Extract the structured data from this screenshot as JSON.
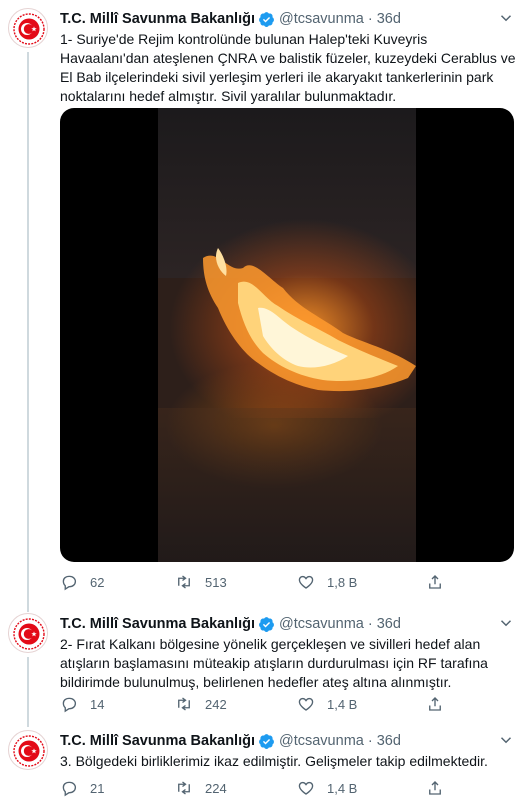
{
  "colors": {
    "text_primary": "#0f1419",
    "text_secondary": "#536471",
    "verified_blue": "#1d9bf0",
    "avatar_red": "#e30a17"
  },
  "tweets": [
    {
      "author_name": "T.C. Millî Savunma Bakanlığı",
      "handle": "@tcsavunma",
      "separator": "·",
      "time": "36d",
      "text": "1- Suriye'de Rejim kontrolünde bulunan Halep'teki Kuveyris Havaalanı'dan ateşlenen ÇNRA ve balistik füzeler, kuzeydeki Cerablus ve El Bab ilçelerindeki sivil yerleşim yerleri ile akaryakıt tankerlerinin park noktalarını hedef almıştır. Sivil yaralılar bulunmaktadır.",
      "has_media": true,
      "replies": "62",
      "retweets": "513",
      "likes": "1,8 B",
      "icons": [
        "reply-icon",
        "retweet-icon",
        "like-icon",
        "share-icon"
      ]
    },
    {
      "author_name": "T.C. Millî Savunma Bakanlığı",
      "handle": "@tcsavunma",
      "separator": "·",
      "time": "36d",
      "text": "2- Fırat Kalkanı bölgesine yönelik gerçekleşen ve sivilleri hedef alan atışların başlamasını müteakip atışların durdurulması için RF tarafına bildirimde bulunulmuş, belirlenen hedefler ateş altına alınmıştır.",
      "has_media": false,
      "replies": "14",
      "retweets": "242",
      "likes": "1,4 B"
    },
    {
      "author_name": "T.C. Millî Savunma Bakanlığı",
      "handle": "@tcsavunma",
      "separator": "·",
      "time": "36d",
      "text": "3. Bölgedeki birliklerimiz ikaz edilmiştir. Gelişmeler takip edilmektedir.",
      "has_media": false,
      "replies": "21",
      "retweets": "224",
      "likes": "1,4 B"
    }
  ]
}
